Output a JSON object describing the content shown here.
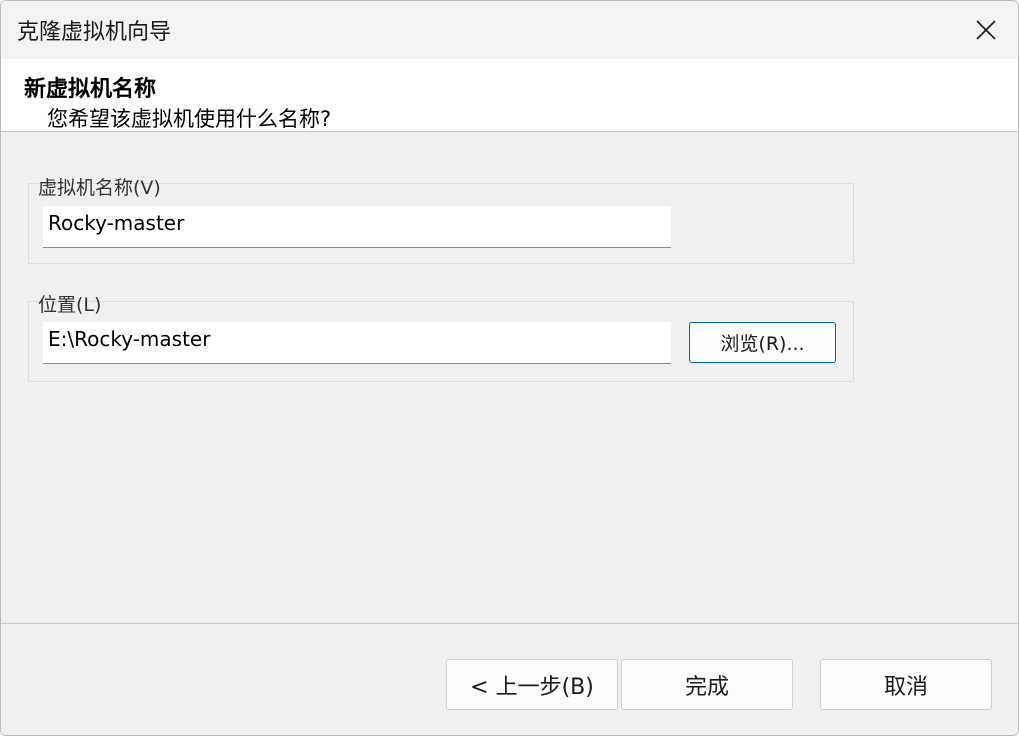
{
  "window": {
    "title": "克隆虚拟机向导"
  },
  "header": {
    "title": "新虚拟机名称",
    "subtitle": "您希望该虚拟机使用什么名称?"
  },
  "name_group": {
    "label": "虚拟机名称(V)",
    "value": "Rocky-master"
  },
  "location_group": {
    "label": "位置(L)",
    "value": "E:\\Rocky-master",
    "browse_label": "浏览(R)..."
  },
  "footer": {
    "back_label": "< 上一步(B)",
    "finish_label": "完成",
    "cancel_label": "取消"
  },
  "colors": {
    "accent_border": "#0067c0",
    "dialog_bg": "#f0f0f0",
    "header_bg": "#ffffff"
  },
  "icons": {
    "close": "close-icon"
  }
}
